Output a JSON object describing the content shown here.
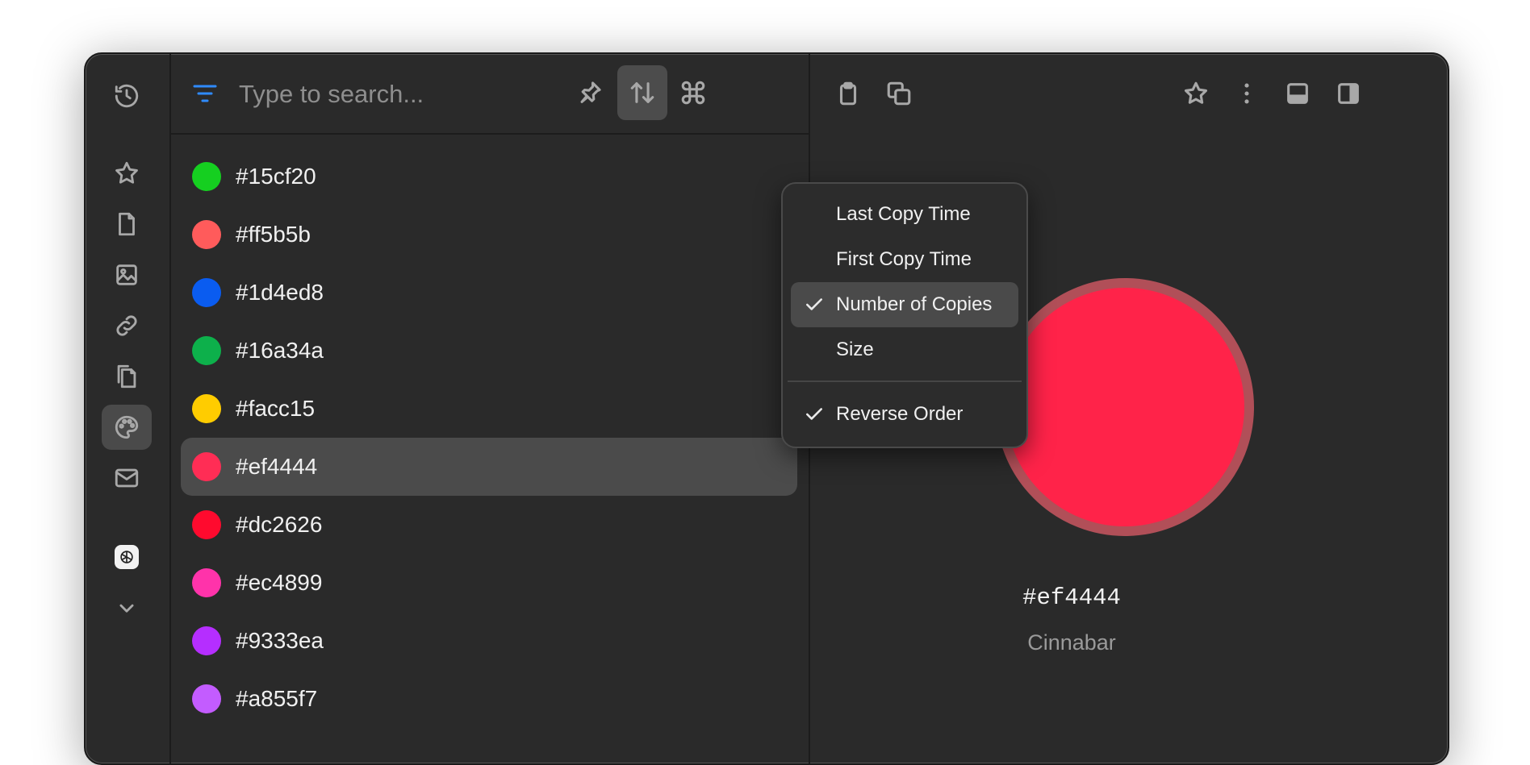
{
  "search": {
    "placeholder": "Type to search..."
  },
  "colors": [
    {
      "hex": "#15cf20",
      "swatch": "#15cf20"
    },
    {
      "hex": "#ff5b5b",
      "swatch": "#ff5b5b"
    },
    {
      "hex": "#1d4ed8",
      "swatch": "#0a5cf0"
    },
    {
      "hex": "#16a34a",
      "swatch": "#0db04b"
    },
    {
      "hex": "#facc15",
      "swatch": "#ffcc00"
    },
    {
      "hex": "#ef4444",
      "swatch": "#ff2d55"
    },
    {
      "hex": "#dc2626",
      "swatch": "#ff0a2e"
    },
    {
      "hex": "#ec4899",
      "swatch": "#ff33aa"
    },
    {
      "hex": "#9333ea",
      "swatch": "#b52eff"
    },
    {
      "hex": "#a855f7",
      "swatch": "#c35cff"
    }
  ],
  "selected_index": 5,
  "detail": {
    "hex": "#ef4444",
    "name": "Cinnabar",
    "swatch_color": "#ff2349"
  },
  "sort_menu": {
    "items": [
      {
        "label": "Last Copy Time",
        "checked": false
      },
      {
        "label": "First Copy Time",
        "checked": false
      },
      {
        "label": "Number of Copies",
        "checked": true
      },
      {
        "label": "Size",
        "checked": false
      }
    ],
    "reverse": {
      "label": "Reverse Order",
      "checked": true
    }
  },
  "icons": {
    "sidebar": [
      "history-icon",
      "star-icon",
      "document-icon",
      "image-icon",
      "link-icon",
      "files-icon",
      "palette-icon",
      "mail-icon",
      "openai-icon",
      "chevron-down-icon"
    ],
    "toolbar": [
      "filter-icon",
      "pin-icon",
      "sort-icon",
      "command-icon"
    ],
    "detail": [
      "clipboard-icon",
      "copy-icon",
      "star-icon",
      "more-icon",
      "layout-bottom-icon",
      "layout-right-icon"
    ]
  },
  "accent_color": "#2f8bff"
}
